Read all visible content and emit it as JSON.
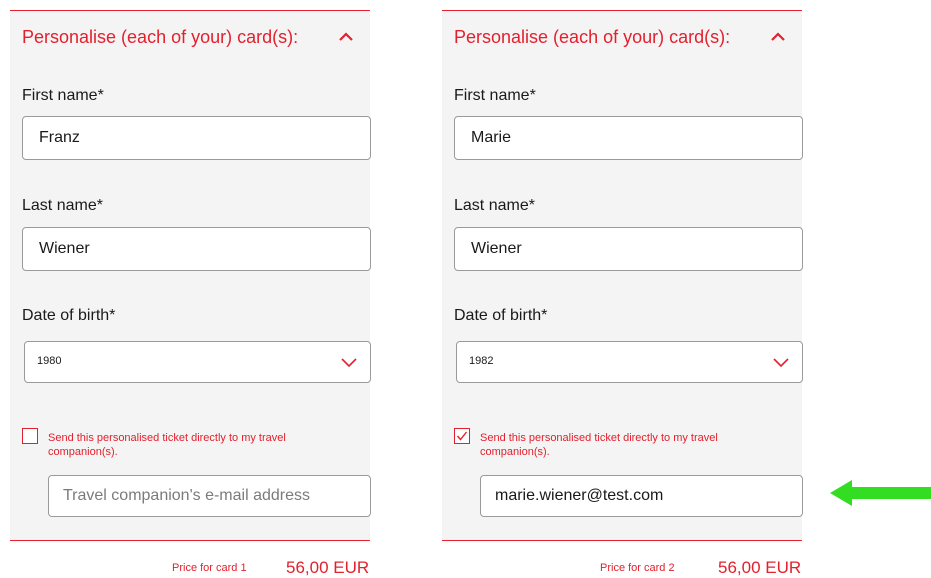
{
  "cards": [
    {
      "title": "Personalise (each of your) card(s):",
      "first_name_label": "First name*",
      "first_name_value": "Franz",
      "last_name_label": "Last name*",
      "last_name_value": "Wiener",
      "dob_label": "Date of birth*",
      "dob_value": "1980",
      "send_checked": false,
      "send_label": "Send this personalised ticket directly to my travel companion(s).",
      "email_value": "",
      "email_placeholder": "Travel companion's e-mail address",
      "price_label": "Price for card 1",
      "price_value": "56,00 EUR"
    },
    {
      "title": "Personalise (each of your) card(s):",
      "first_name_label": "First name*",
      "first_name_value": "Marie",
      "last_name_label": "Last name*",
      "last_name_value": "Wiener",
      "dob_label": "Date of birth*",
      "dob_value": "1982",
      "send_checked": true,
      "send_label": "Send this personalised ticket directly to my travel companion(s).",
      "email_value": "marie.wiener@test.com",
      "email_placeholder": "Travel companion's e-mail address",
      "price_label": "Price for card 2",
      "price_value": "56,00 EUR"
    }
  ],
  "colors": {
    "accent": "#e3202e",
    "panel_bg": "#f4f4f4",
    "arrow": "#33dd22"
  },
  "icons": {
    "collapse": "chevron-up-icon",
    "select": "chevron-down-icon",
    "check": "checkmark-icon",
    "annotation": "arrow-left-icon"
  }
}
